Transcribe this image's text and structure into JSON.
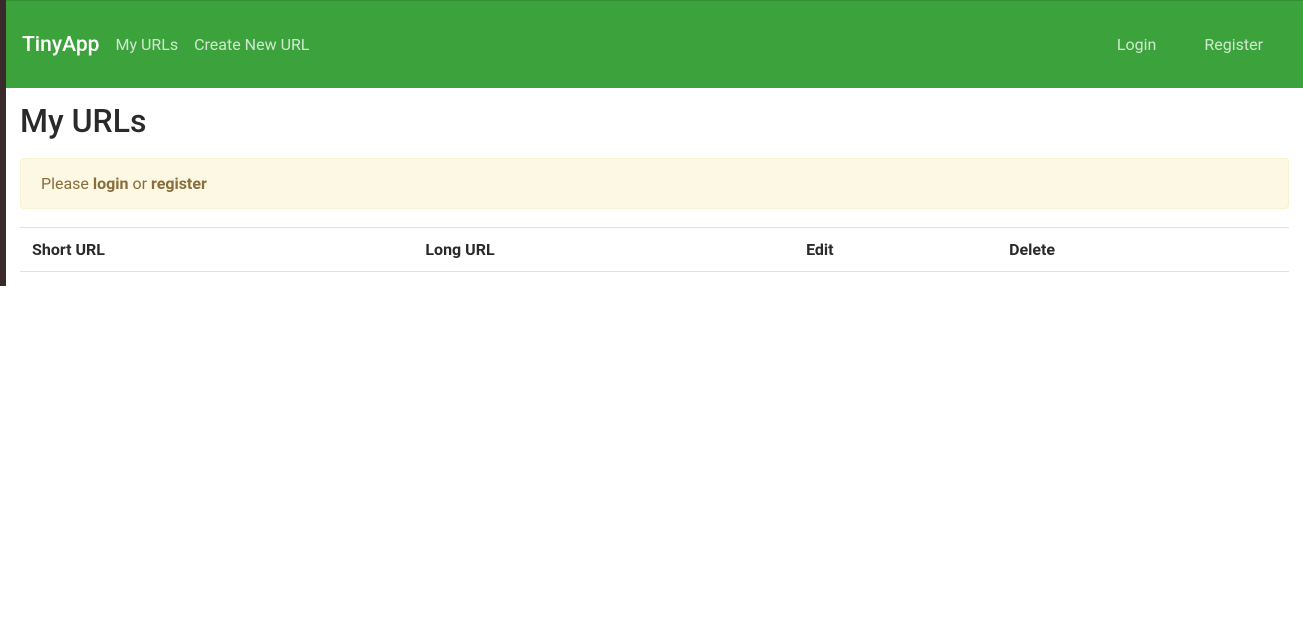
{
  "navbar": {
    "brand": "TinyApp",
    "links": {
      "my_urls": "My URLs",
      "create_new": "Create New URL"
    },
    "right": {
      "login": "Login",
      "register": "Register"
    }
  },
  "page": {
    "title": "My URLs"
  },
  "alert": {
    "prefix": "Please ",
    "login": "login",
    "middle": " or ",
    "register": "register"
  },
  "table": {
    "headers": {
      "short_url": "Short URL",
      "long_url": "Long URL",
      "edit": "Edit",
      "delete": "Delete"
    }
  }
}
